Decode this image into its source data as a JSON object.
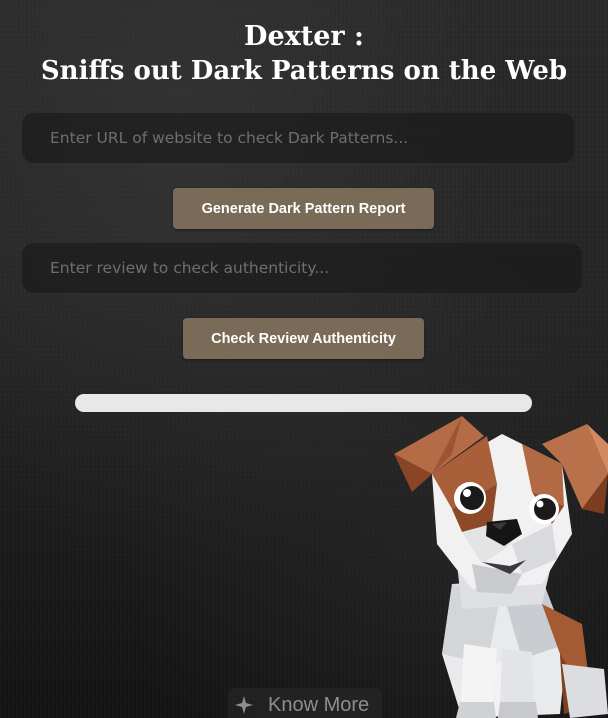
{
  "header": {
    "title_line1": "Dexter :",
    "title_line2": "Sniffs out Dark Patterns on the Web"
  },
  "url_check": {
    "placeholder": "Enter URL of website to check Dark Patterns...",
    "value": "",
    "button_label": "Generate Dark Pattern Report"
  },
  "review_check": {
    "placeholder": "Enter review to check authenticity...",
    "value": "",
    "button_label": "Check Review Authenticity"
  },
  "progress": {
    "fraction": 0
  },
  "footer": {
    "know_more_label": "Know More",
    "know_more_icon": "sparkle-icon"
  },
  "mascot": {
    "icon": "dog-mascot"
  },
  "colors": {
    "accent": "#7a6a58",
    "background": "#252525",
    "text": "#ffffff",
    "placeholder": "#6f6f6f"
  }
}
